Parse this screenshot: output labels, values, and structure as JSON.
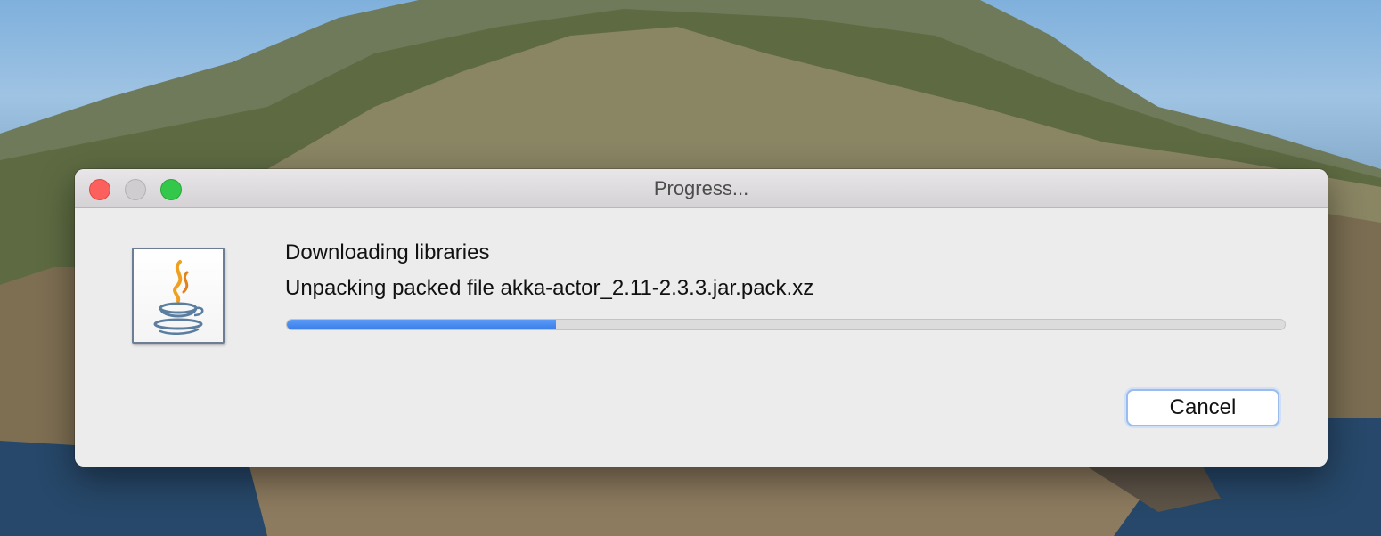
{
  "window": {
    "title": "Progress..."
  },
  "dialog": {
    "heading": "Downloading libraries",
    "status": "Unpacking packed file akka-actor_2.11-2.3.3.jar.pack.xz",
    "progress_fraction": 0.27,
    "cancel_label": "Cancel",
    "icon": "java-coffee-cup-icon"
  },
  "colors": {
    "close": "#fc605c",
    "minimize": "#cfcdcf",
    "zoom": "#34c84a",
    "progress_accent": "#3a7ee8"
  }
}
